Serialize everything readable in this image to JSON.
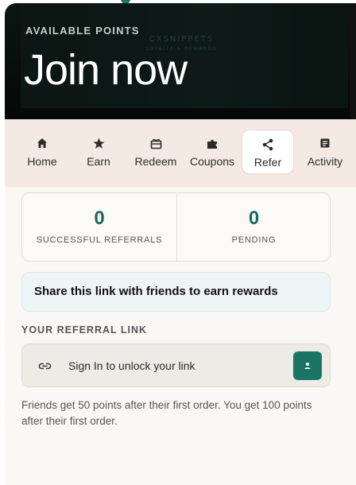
{
  "hero": {
    "eyebrow": "AVAILABLE POINTS",
    "title": "Join now",
    "watermark_line1": "CXSNIPPETS",
    "watermark_line2": "LOYALTY & REWARDS"
  },
  "tabs": [
    {
      "label": "Home",
      "icon": "home-icon",
      "active": false
    },
    {
      "label": "Earn",
      "icon": "star-icon",
      "active": false
    },
    {
      "label": "Redeem",
      "icon": "gift-icon",
      "active": false
    },
    {
      "label": "Coupons",
      "icon": "puzzle-icon",
      "active": false
    },
    {
      "label": "Refer",
      "icon": "share-icon",
      "active": true
    },
    {
      "label": "Activity",
      "icon": "list-icon",
      "active": false
    }
  ],
  "stats": {
    "successful": {
      "value": "0",
      "caption": "SUCCESSFUL REFERRALS"
    },
    "pending": {
      "value": "0",
      "caption": "PENDING"
    }
  },
  "share": {
    "text": "Share this link with friends to earn rewards"
  },
  "referral": {
    "section_label": "YOUR REFERRAL LINK",
    "placeholder": "Sign In to unlock your link",
    "link_icon": "link-icon",
    "button_icon": "user-badge-icon"
  },
  "footnote": "Friends get 50 points after their first order. You get 100 points after their first order.",
  "colors": {
    "accent": "#1b7565",
    "stat_value": "#1b6b5d",
    "hero_bg": "#0b1512",
    "tabs_bg": "#f4e9e3"
  }
}
